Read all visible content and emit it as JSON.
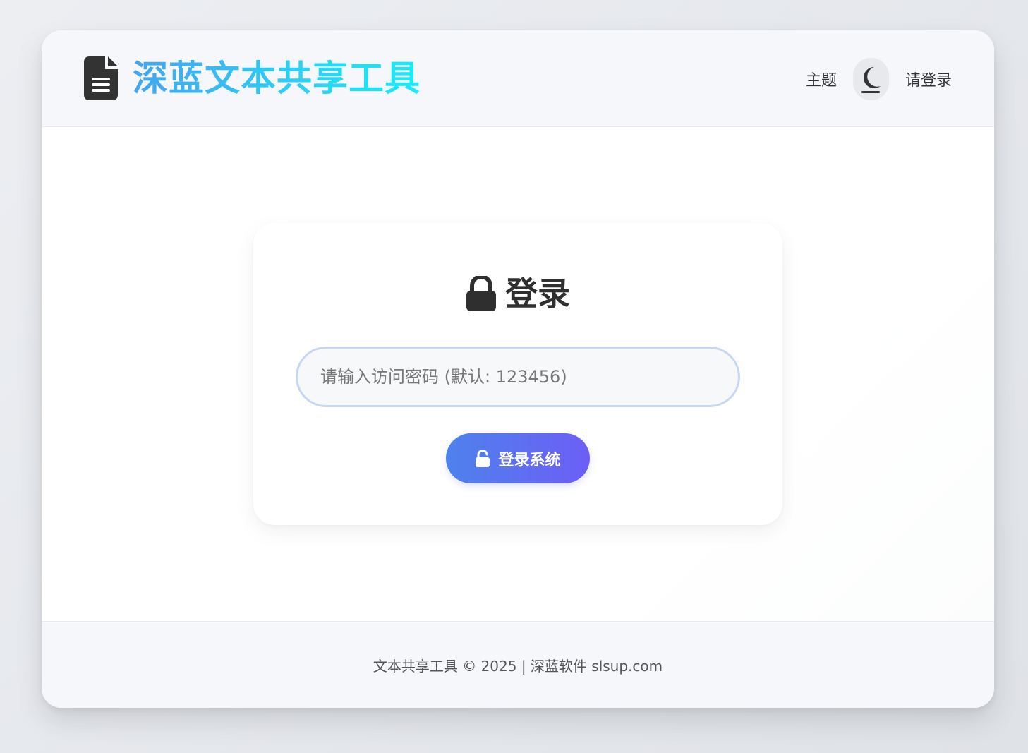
{
  "header": {
    "brand_icon": "file-lines-icon",
    "title": "深蓝文本共享工具",
    "theme_label": "主题",
    "theme_toggle_icon": "moon-icon",
    "login_link": "请登录"
  },
  "login_card": {
    "title_icon": "lock-icon",
    "title": "登录",
    "password_placeholder": "请输入访问密码 (默认: 123456)",
    "password_value": "",
    "button_icon": "unlock-icon",
    "button_label": "登录系统"
  },
  "footer": {
    "text": "文本共享工具 © 2025 | 深蓝软件 slsup.com"
  },
  "colors": {
    "brand_gradient_start": "#44a4f0",
    "brand_gradient_end": "#16ecf8",
    "button_gradient_start": "#4e82ec",
    "button_gradient_end": "#6c5ef6",
    "input_border": "#c6d8f1",
    "text_dark": "#333333"
  }
}
